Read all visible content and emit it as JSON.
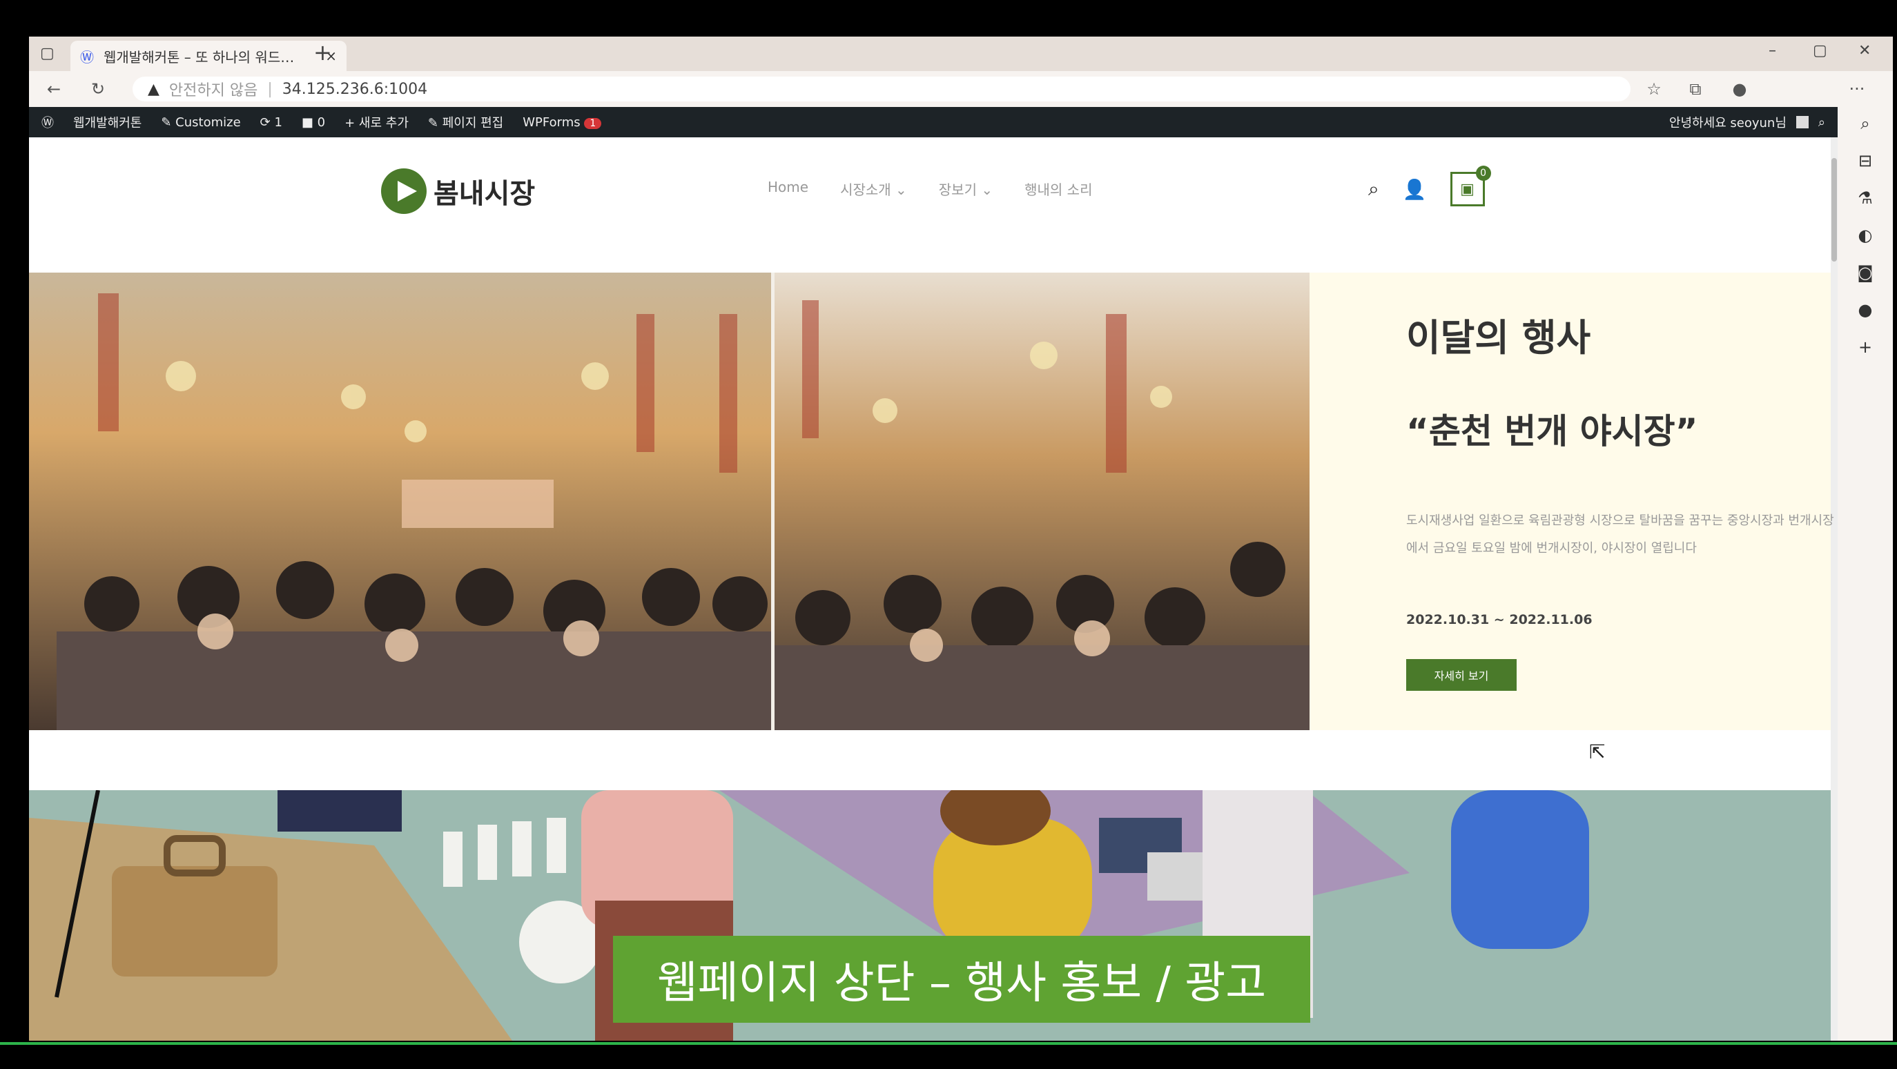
{
  "browser": {
    "tab_title": "웹개발해커톤 – 또 하나의 워드…",
    "tab_close": "×",
    "new_tab": "+",
    "security_label": "안전하지 않음",
    "url": "34.125.236.6:1004",
    "window_controls": [
      "–",
      "▢",
      "✕"
    ],
    "more": "···"
  },
  "wp_admin_bar": {
    "site_name": "웹개발해커톤",
    "customize": "Customize",
    "updates": "1",
    "comments": "0",
    "new": "새로 추가",
    "edit_page": "페이지 편집",
    "wpforms": "WPForms",
    "wpforms_badge": "1",
    "greeting": "안녕하세요 seoyun님"
  },
  "site": {
    "logo_text": "봄내시장",
    "nav": [
      "Home",
      "시장소개 ⌄",
      "장보기 ⌄",
      "행내의 소리"
    ],
    "cart_count": "0"
  },
  "event": {
    "heading": "이달의 행사",
    "title": "“춘천 번개 야시장”",
    "description": "도시재생사업 일환으로 육림관광형 시장으로 탈바꿈을 꿈꾸는 중앙시장과 번개시장에서 금요일 토요일 밤에 번개시장이, 야시장이 열립니다",
    "date": "2022.10.31 ~ 2022.11.06",
    "button": "자세히 보기"
  },
  "caption": "웹페이지 상단 – 행사 홍보 / 광고",
  "colors": {
    "brand": "#4a7a2a",
    "caption_bg": "#5fa332",
    "wp_bar": "#1d2327"
  }
}
